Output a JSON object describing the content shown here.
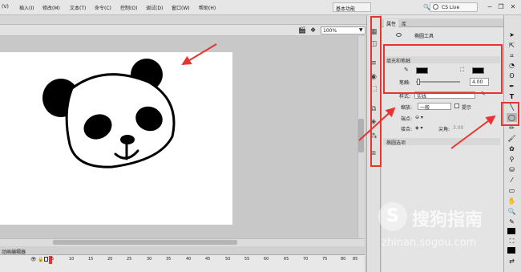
{
  "menu": {
    "items": [
      "(V)",
      "插入(I)",
      "修改(M)",
      "文本(T)",
      "命令(C)",
      "控制(O)",
      "调试(D)",
      "窗口(W)",
      "帮助(H)"
    ],
    "workspace": "基本功能",
    "search_placeholder": "CS Live"
  },
  "stage": {
    "zoom": "100%"
  },
  "properties": {
    "tabs": [
      "属性",
      "库"
    ],
    "tool_name": "椭圆工具",
    "fill_stroke_section": "填充和笔触",
    "stroke_label": "笔触:",
    "stroke_value": "4.00",
    "style_label": "样式:",
    "style_value": "实线",
    "scale_label": "缩放:",
    "scale_value": "一般",
    "hint_label": "提示",
    "cap_label": "端点:",
    "join_label": "接合:",
    "miter_label": "尖角:",
    "miter_value": "3.00",
    "ellipse_section": "椭圆选项"
  },
  "timeline": {
    "tab": "动画编辑器",
    "ticks": [
      "5",
      "10",
      "15",
      "20",
      "25",
      "30",
      "35",
      "40",
      "45",
      "50",
      "55",
      "60",
      "65",
      "70",
      "75",
      "80",
      "85",
      "90"
    ]
  },
  "watermark": {
    "title": "搜狗指南",
    "url": "zhinan.sogou.com"
  },
  "colors": {
    "annotation_red": "#e8342f",
    "stroke_color": "#000000",
    "fill_color": "#000000"
  }
}
